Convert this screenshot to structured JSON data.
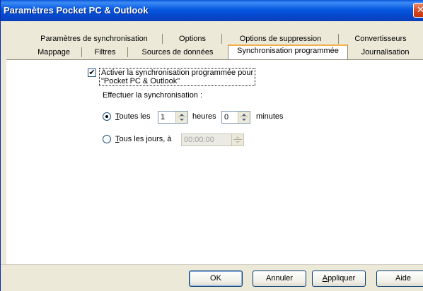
{
  "window": {
    "title": "Paramètres Pocket PC & Outlook",
    "close_glyph": "✕"
  },
  "tabs": {
    "row1": [
      {
        "label": "Paramètres de synchronisation"
      },
      {
        "label": "Options"
      },
      {
        "label": "Options de suppression"
      },
      {
        "label": "Convertisseurs"
      }
    ],
    "row2": [
      {
        "label": "Mappage"
      },
      {
        "label": "Filtres"
      },
      {
        "label": "Sources de données"
      },
      {
        "label": "Synchronisation programmée",
        "active": true
      },
      {
        "label": "Journalisation"
      }
    ]
  },
  "schedule": {
    "enable_checked": true,
    "checkmark": "✔",
    "enable_label_line1": "Activer la synchronisation programmée pour",
    "enable_label_line2": "\"Pocket PC & Outlook\"",
    "perform_label": "Effectuer la synchronisation :",
    "every_selected": true,
    "every_label_first": "T",
    "every_label_rest": "outes les",
    "hours_value": "1",
    "hours_unit": "heures",
    "minutes_value": "0",
    "minutes_unit": "minutes",
    "daily_label_first": "T",
    "daily_label_rest": "ous les jours, à",
    "daily_time_value": "00:00:00",
    "daily_time_disabled": true
  },
  "buttons": {
    "ok": "OK",
    "cancel": "Annuler",
    "apply_first": "A",
    "apply_rest": "ppliquer",
    "help": "Aide"
  }
}
